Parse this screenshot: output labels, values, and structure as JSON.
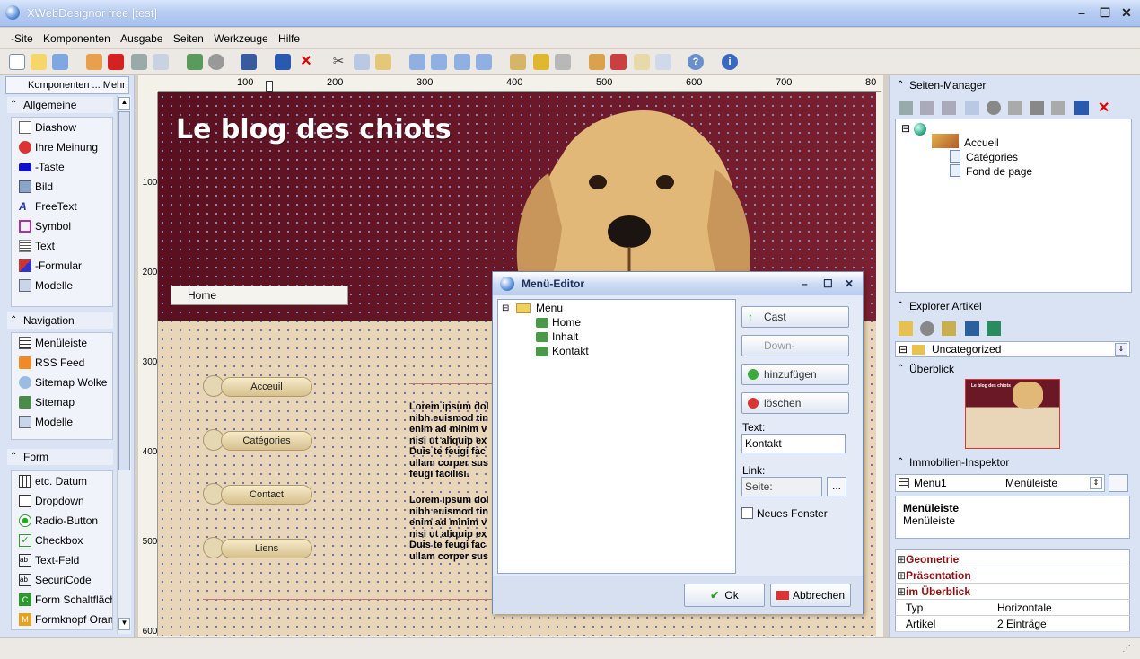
{
  "window": {
    "title": "XWebDesignor free [test]"
  },
  "menu": [
    "-Site",
    "Komponenten",
    "Ausgabe",
    "Seiten",
    "Werkzeuge",
    "Hilfe"
  ],
  "left_panel": {
    "tab_label": "Komponenten ... Mehr",
    "sections": [
      {
        "title": "Allgemeine",
        "items": [
          "Diashow",
          "Ihre Meinung",
          "-Taste",
          "Bild",
          "FreeText",
          "Symbol",
          "Text",
          "-Formular",
          "Modelle"
        ]
      },
      {
        "title": "Navigation",
        "items": [
          "Menüleiste",
          "RSS Feed",
          "Sitemap Wolke",
          "Sitemap",
          "Modelle"
        ]
      },
      {
        "title": "Form",
        "items": [
          "etc. Datum",
          "Dropdown",
          "Radio-Button",
          "Checkbox",
          "Text-Feld",
          "SecuriCode",
          "Form Schaltfläche",
          "Formknopf Orange"
        ]
      }
    ]
  },
  "ruler": {
    "top": [
      "100",
      "200",
      "300",
      "400",
      "500",
      "600",
      "700",
      "80"
    ],
    "left": [
      "100",
      "200",
      "300",
      "400",
      "500",
      "600"
    ]
  },
  "page": {
    "site_title": "Le blog des chiots",
    "home_bar": "Home",
    "nav_buttons": [
      "Acceuil",
      "Catégories",
      "Contact",
      "Liens"
    ],
    "lorem1": [
      "Lorem ipsum dol",
      "nibh euismod tin",
      "enim ad minim v",
      "nisi ut aliquip ex",
      "Duis te feugi fac",
      "ullam corper sus",
      "feugi facilisi."
    ],
    "lorem2": [
      "Lorem ipsum dol",
      "nibh euismod tin",
      "enim ad minim v",
      "nisi ut aliquip ex",
      "Duis te feugi fac",
      "ullam corper sus"
    ]
  },
  "dialog": {
    "title": "Menü-Editor",
    "tree_root": "Menu",
    "tree_items": [
      "Home",
      "Inhalt",
      "Kontakt"
    ],
    "buttons": {
      "cast": "Cast",
      "down": "Down-",
      "add": "hinzufügen",
      "delete": "löschen"
    },
    "text_label": "Text:",
    "text_value": "Kontakt",
    "link_label": "Link:",
    "link_value": "Seite:",
    "browse": "...",
    "new_window": "Neues Fenster",
    "ok": "Ok",
    "cancel": "Abbrechen"
  },
  "right_panel": {
    "pages_title": "Seiten-Manager",
    "pages": [
      "Accueil",
      "Catégories",
      "Fond de page"
    ],
    "explorer_title": "Explorer Artikel",
    "explorer_value": "Uncategorized",
    "overview_title": "Überblick",
    "inspector_title": "Immobilien-Inspektor",
    "inspector_object": "Menu1",
    "inspector_type": "Menüleiste",
    "inspector_desc_title": "Menüleiste",
    "inspector_desc": "Menüleiste",
    "groups": [
      "Geometrie",
      "Präsentation",
      "im Überblick"
    ],
    "props": [
      {
        "key": "Typ",
        "value": "Horizontale"
      },
      {
        "key": "Artikel",
        "value": "2 Einträge"
      }
    ]
  }
}
